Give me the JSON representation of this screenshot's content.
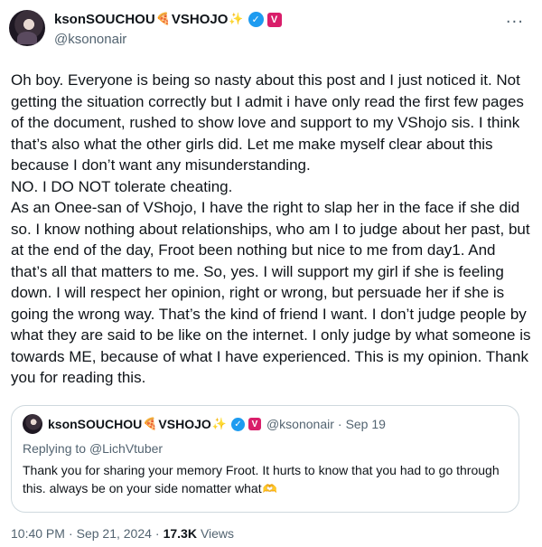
{
  "author": {
    "display_name": "ksonSOUCHOU",
    "name_suffix": "VSHOJO",
    "emoji_pizza": "🍕",
    "emoji_sparkle": "✨",
    "handle": "@ksononair",
    "verified_icon": "✓",
    "affiliate_badge": "V"
  },
  "more_icon": "···",
  "body": "Oh boy. Everyone is being so nasty about this post and I just noticed it. Not getting the situation correctly but I admit i have only read the first few pages of the document, rushed to show love and support to my VShojo sis. I think that’s also what the other girls did. Let me make myself clear about this because I don’t want any misunderstanding.\nNO. I DO NOT tolerate cheating.\nAs an Onee-san of VShojo, I have the right to slap her in the face if she did so. I know nothing about relationships, who am I to judge about her past, but at the end of the day, Froot been nothing but nice to me from day1. And that’s all that matters to me. So, yes. I will support my girl if she is feeling down. I will respect her opinion, right or wrong, but persuade her if she is going the wrong way. That’s the kind of friend I want. I don’t judge people by what they are said to be like on the internet. I only judge by what someone is towards ME, because of what I have experienced. This is my opinion. Thank you for reading this.",
  "quote": {
    "display_name": "ksonSOUCHOU",
    "name_suffix": "VSHOJO",
    "emoji_pizza": "🍕",
    "emoji_sparkle": "✨",
    "handle": "@ksononair",
    "separator": "·",
    "date": "Sep 19",
    "replying_prefix": "Replying to ",
    "replying_to": "@LichVtuber",
    "text": "Thank you for sharing your memory Froot. It hurts to know that you had to go through this. always be on your side nomatter what",
    "emoji_heart": "🫶"
  },
  "meta": {
    "time": "10:40 PM",
    "separator": "·",
    "date": "Sep 21, 2024",
    "views_count": "17.3K",
    "views_label": "Views"
  }
}
